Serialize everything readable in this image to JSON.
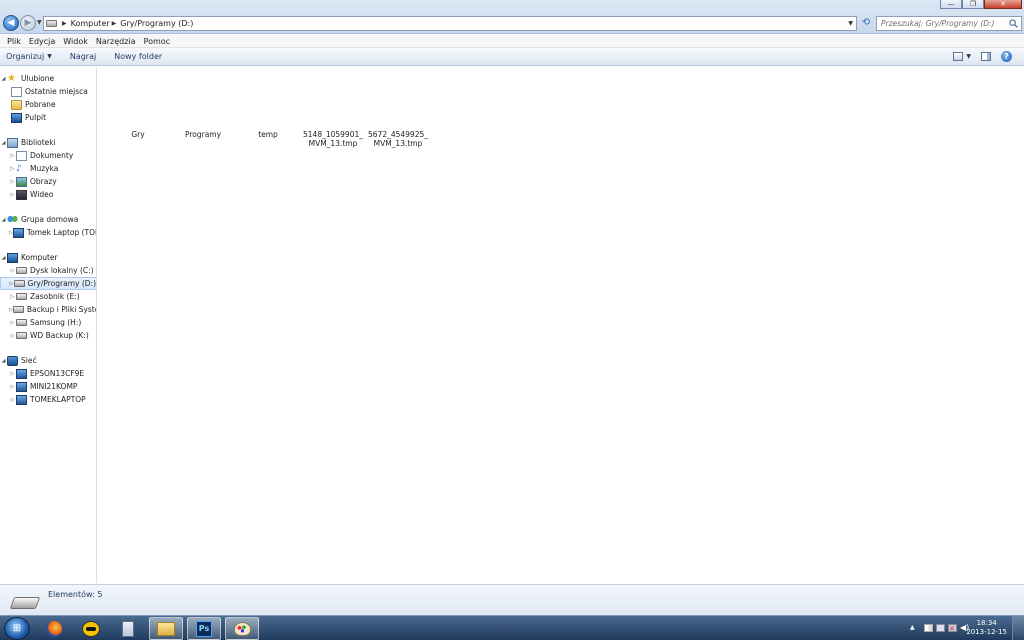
{
  "window": {
    "minimize_label": "—",
    "maximize_label": "❐",
    "close_label": "✕"
  },
  "navigation": {
    "back_glyph": "◀",
    "forward_glyph": "▶",
    "history_glyph": "▼",
    "refresh_glyph": "⟲"
  },
  "address": {
    "separator": "▶",
    "crumbs": [
      "Komputer",
      "Gry/Programy (D:)"
    ],
    "dropdown_glyph": "▼"
  },
  "search": {
    "placeholder": "Przeszukaj: Gry/Programy (D:)"
  },
  "menu": [
    "Plik",
    "Edycja",
    "Widok",
    "Narzędzia",
    "Pomoc"
  ],
  "command_bar": {
    "organize": "Organizuj",
    "organize_caret": "▼",
    "burn": "Nagraj",
    "new_folder": "Nowy folder",
    "view_caret": "▼",
    "help": "?"
  },
  "nav_pane": {
    "expanded_glyph": "◢",
    "collapsed_glyph": "▷",
    "favorites": {
      "label": "Ulubione",
      "items": [
        "Ostatnie miejsca",
        "Pobrane",
        "Pulpit"
      ]
    },
    "libraries": {
      "label": "Biblioteki",
      "items": [
        "Dokumenty",
        "Muzyka",
        "Obrazy",
        "Wideo"
      ]
    },
    "homegroup": {
      "label": "Grupa domowa",
      "items": [
        "Tomek Laptop (TOMEKLAPTOP)"
      ]
    },
    "computer": {
      "label": "Komputer",
      "items": [
        "Dysk lokalny (C:)",
        "Gry/Programy (D:)",
        "Zasobnik (E:)",
        "Backup i Pliki Systemowe (F:)",
        "Samsung  (H:)",
        "WD Backup (K:)"
      ],
      "selected": "Gry/Programy (D:)"
    },
    "network": {
      "label": "Sieć",
      "items": [
        "EPSON13CF9E",
        "MINI21KOMP",
        "TOMEKLAPTOP"
      ]
    }
  },
  "files": [
    {
      "name": "Gry"
    },
    {
      "name": "Programy"
    },
    {
      "name": "temp"
    },
    {
      "name": "5148_1059901_MVM_13.tmp"
    },
    {
      "name": "5672_4549925_MVM_13.tmp"
    }
  ],
  "details": {
    "count_text": "Elementów: 5"
  },
  "taskbar": {
    "start_glyph": "⊞",
    "apps": [
      "firefox",
      "batman",
      "notes",
      "explorer",
      "photoshop",
      "paint"
    ],
    "photoshop_label": "Ps",
    "tray_arrow": "▲",
    "volume_glyph": "◀)",
    "network_error_glyph": "✕",
    "time": "18:34",
    "date": "2013-12-15"
  }
}
